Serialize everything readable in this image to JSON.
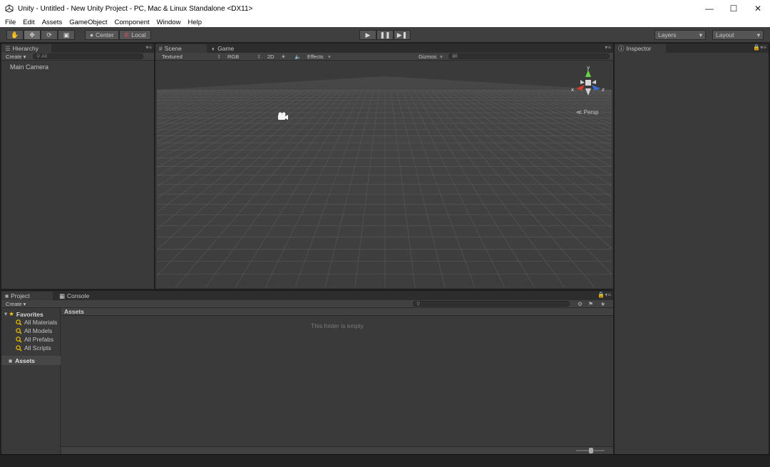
{
  "window": {
    "title": "Unity - Untitled - New Unity Project - PC, Mac & Linux Standalone <DX11>",
    "controls": [
      "minimize-icon",
      "maximize-icon",
      "close-icon"
    ]
  },
  "menu": [
    "File",
    "Edit",
    "Assets",
    "GameObject",
    "Component",
    "Window",
    "Help"
  ],
  "toolbar": {
    "pivot_label": "Center",
    "space_label": "Local",
    "layers_label": "Layers",
    "layout_label": "Layout"
  },
  "hierarchy": {
    "tab_label": "Hierarchy",
    "create_label": "Create",
    "search_placeholder": "All",
    "items": [
      "Main Camera"
    ]
  },
  "scene": {
    "tab_scene": "Scene",
    "tab_game": "Game",
    "shading_mode": "Textured",
    "render_mode": "RGB",
    "mode_2d": "2D",
    "effects_label": "Effects",
    "gizmos_label": "Gizmos",
    "search_placeholder": "All",
    "persp_label": "Persp",
    "axis_y": "y",
    "axis_x": "x",
    "axis_z": "z"
  },
  "inspector": {
    "tab_label": "Inspector"
  },
  "project": {
    "tab_project": "Project",
    "tab_console": "Console",
    "create_label": "Create",
    "favorites_label": "Favorites",
    "favorites": [
      "All Materials",
      "All Models",
      "All Prefabs",
      "All Scripts"
    ],
    "assets_folder": "Assets",
    "assets_header": "Assets",
    "empty_message": "This folder is empty"
  },
  "colors": {
    "accent_y": "#6bd345",
    "accent_x": "#d33b2f",
    "accent_z": "#3a6bd5",
    "star": "#f5c518",
    "lens": "#e8b900"
  }
}
